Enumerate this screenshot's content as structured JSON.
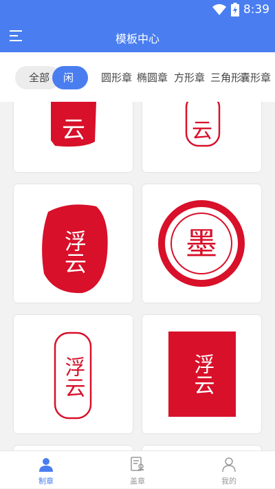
{
  "status": {
    "time": "8:39"
  },
  "header": {
    "title": "模板中心"
  },
  "tabs": [
    {
      "label": "全部"
    },
    {
      "label": "闲"
    },
    {
      "label": "圆形章"
    },
    {
      "label": "椭圆章"
    },
    {
      "label": "方形章"
    },
    {
      "label": "三角形"
    },
    {
      "label": "囊形章"
    }
  ],
  "seals": [
    {
      "text": "云"
    },
    {
      "text": "云"
    },
    {
      "text": "浮云"
    },
    {
      "text": "墨"
    },
    {
      "text": "浮云"
    },
    {
      "text": "浮云"
    }
  ],
  "nav": [
    {
      "label": "制章"
    },
    {
      "label": "盖章"
    },
    {
      "label": "我的"
    }
  ],
  "colors": {
    "primary": "#4a7ef0",
    "seal_red": "#d8102a"
  }
}
